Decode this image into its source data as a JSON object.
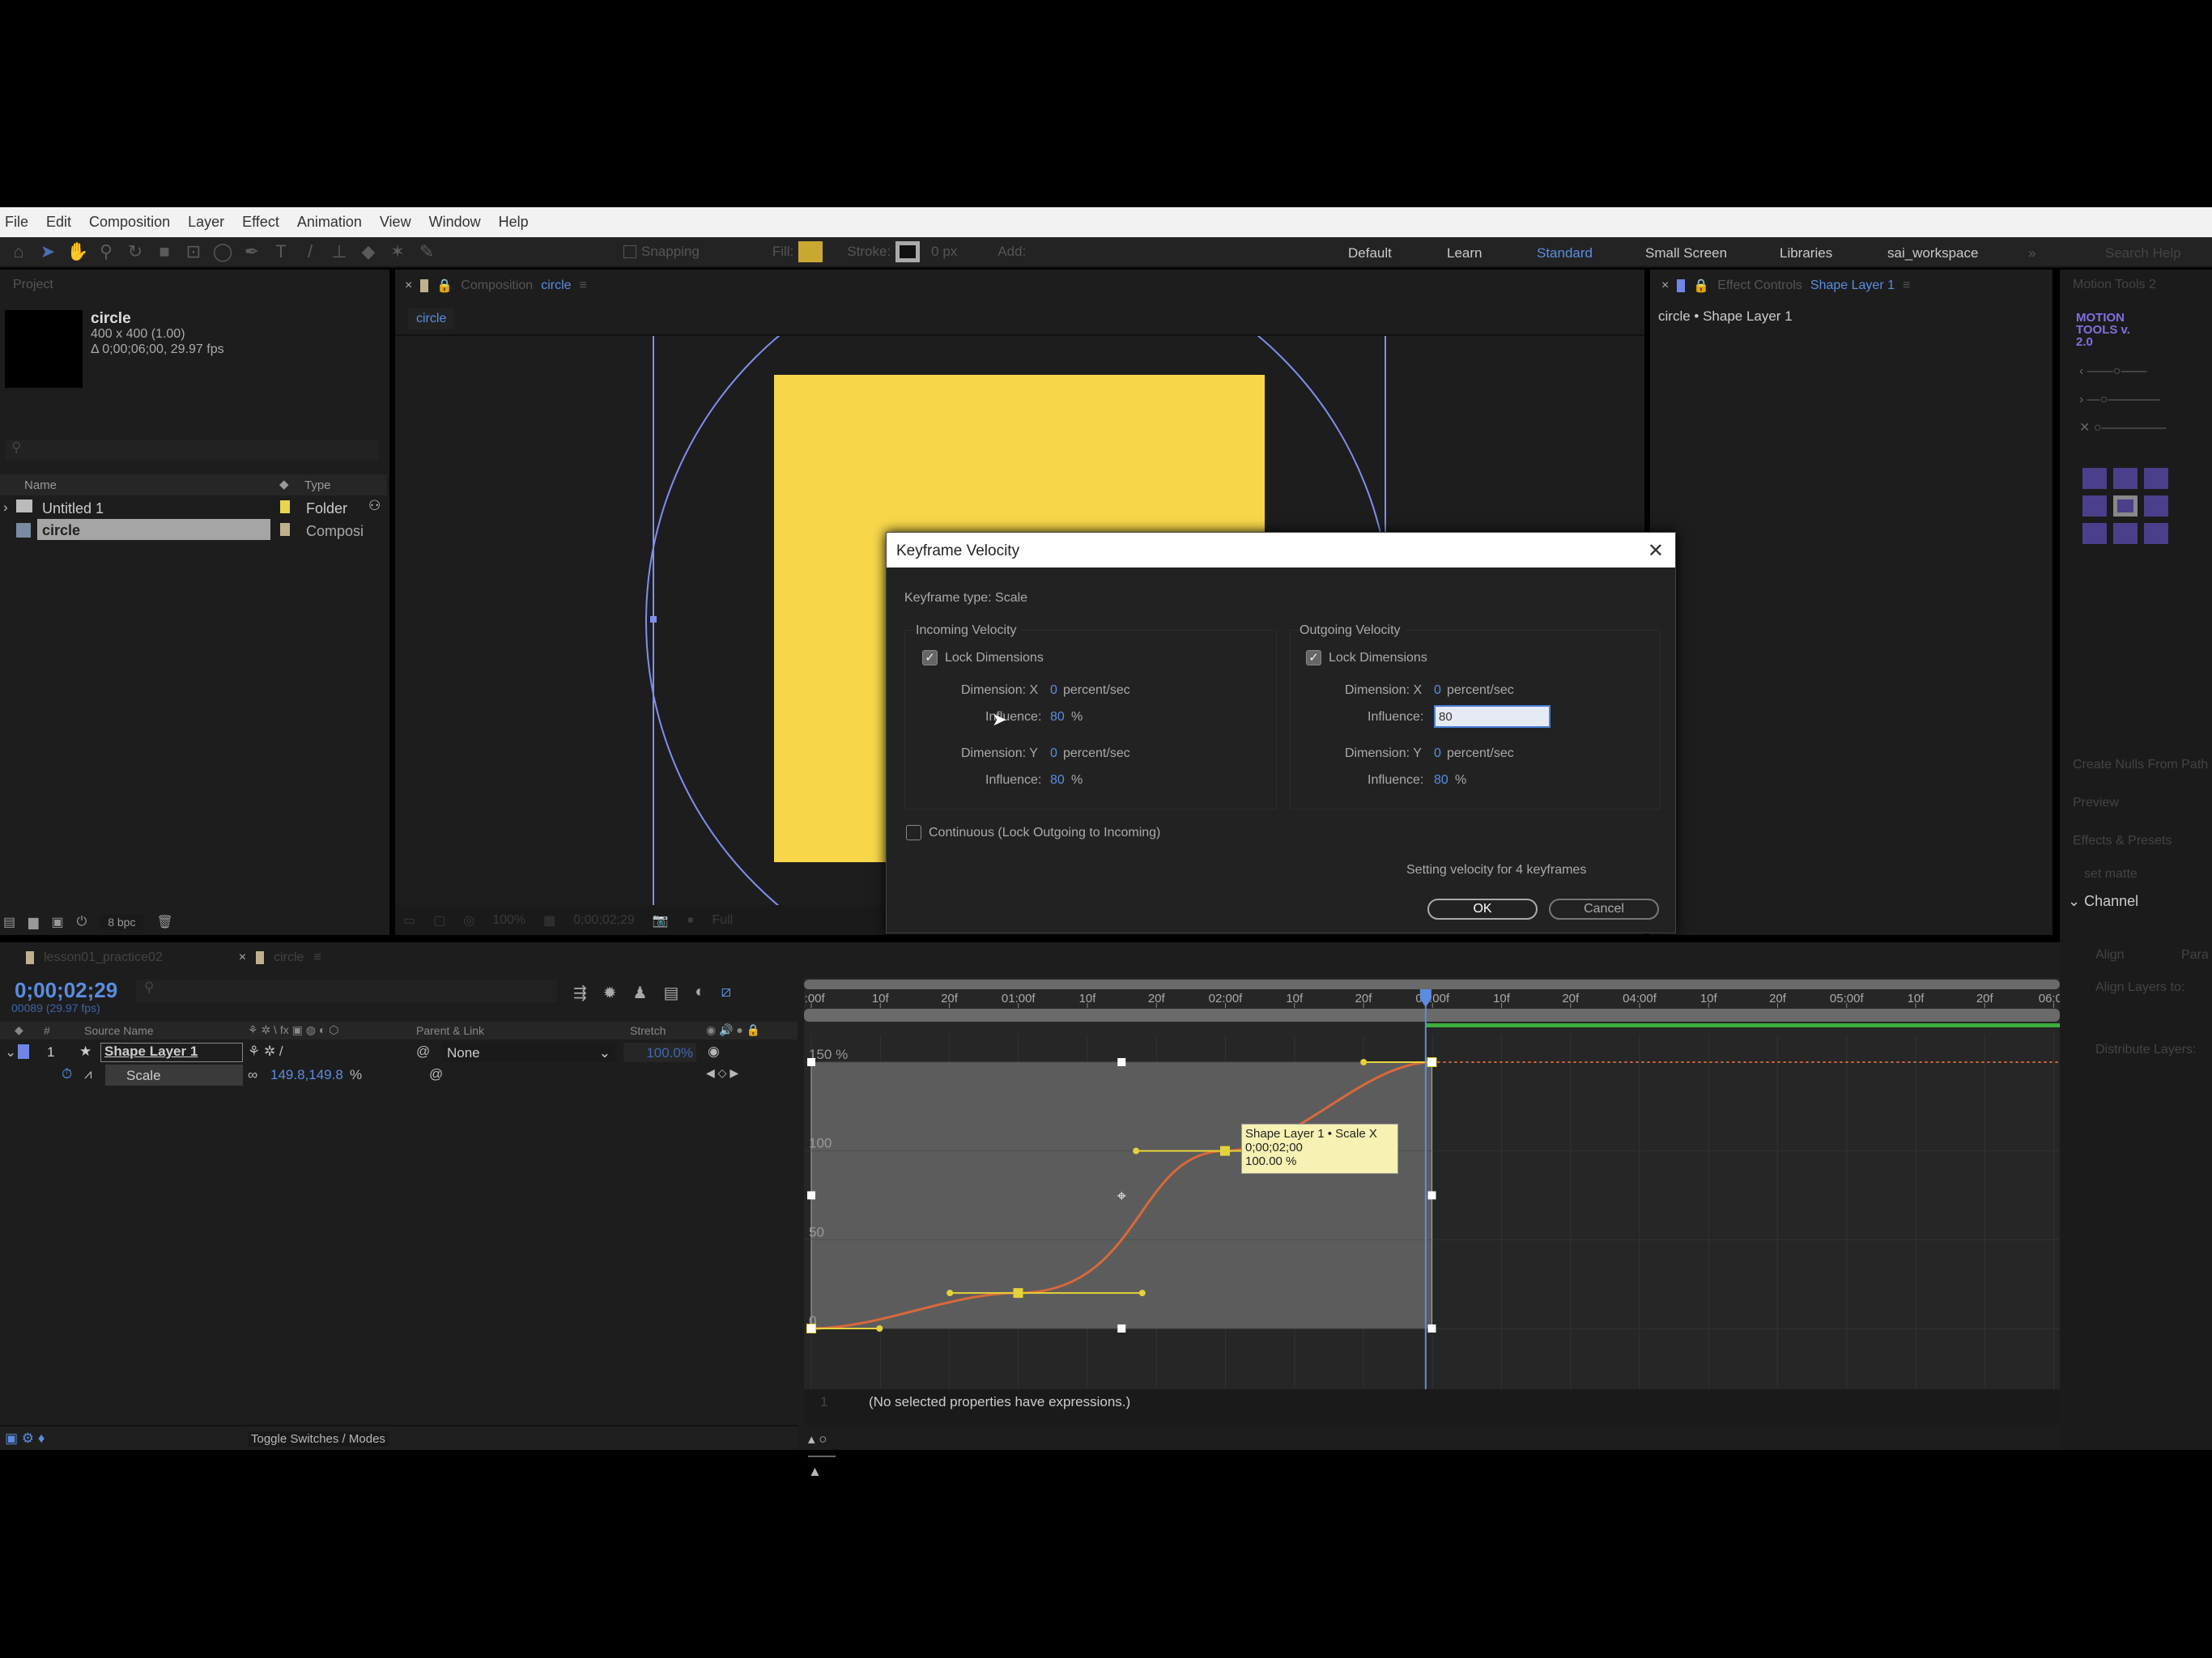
{
  "menu": [
    "File",
    "Edit",
    "Composition",
    "Layer",
    "Effect",
    "Animation",
    "View",
    "Window",
    "Help"
  ],
  "toolbar": {
    "snapping": "Snapping",
    "fill": "Fill:",
    "stroke": "Stroke:",
    "stroke_px": "0 px",
    "add": "Add:",
    "fill_color": "#c9a832",
    "search_placeholder": "Search Help"
  },
  "workspaces": [
    {
      "label": "Default"
    },
    {
      "label": "Learn"
    },
    {
      "label": "Standard",
      "active": true
    },
    {
      "label": "Small Screen"
    },
    {
      "label": "Libraries"
    },
    {
      "label": "sai_workspace"
    }
  ],
  "project": {
    "title": "Project",
    "comp_name": "circle",
    "comp_size": "400 x 400 (1.00)",
    "comp_duration": "Δ 0;00;06;00, 29.97 fps",
    "columns": {
      "name": "Name",
      "type": "Type"
    },
    "items": [
      {
        "name": "Untitled 1",
        "type": "Folder",
        "label_color": "#e8d44d"
      },
      {
        "name": "circle",
        "type": "Composi",
        "label_color": "#c0b090",
        "selected": true
      }
    ],
    "bpc": "8 bpc"
  },
  "composition": {
    "tab_prefix": "Composition",
    "tab_name": "circle",
    "breadcrumb": "circle",
    "zoom": "100%",
    "timecode": "0;00;02;29",
    "resolution": "Full",
    "shape_color": "#f7d64a",
    "path_color": "#7f8ff0"
  },
  "effect_controls": {
    "tab_prefix": "Effect Controls",
    "tab_name": "Shape Layer 1",
    "header": "circle • Shape Layer 1"
  },
  "right_panel": {
    "motion_tools_tab": "Motion Tools 2",
    "logo": "MOTION TOOLS v. 2.0",
    "create_nulls": "Create Nulls From Path",
    "preview": "Preview",
    "effects_presets": "Effects & Presets",
    "effects_search": "set matte",
    "channel": "Channel",
    "align": "Align",
    "para": "Para",
    "align_layers_to": "Align Layers to:",
    "distribute": "Distribute Layers:"
  },
  "dialog": {
    "title": "Keyframe Velocity",
    "keyframe_type": "Keyframe type: Scale",
    "incoming": {
      "title": "Incoming Velocity",
      "lock": "Lock Dimensions",
      "locked": true,
      "dim_x_label": "Dimension: X",
      "dim_x": "0",
      "dim_y_label": "Dimension: Y",
      "dim_y": "0",
      "unit": "percent/sec",
      "influence_label": "Influence:",
      "influence_x": "80",
      "influence_y": "80",
      "pct": "%"
    },
    "outgoing": {
      "title": "Outgoing Velocity",
      "lock": "Lock Dimensions",
      "locked": true,
      "dim_x_label": "Dimension: X",
      "dim_x": "0",
      "dim_y_label": "Dimension: Y",
      "dim_y": "0",
      "unit": "percent/sec",
      "influence_label": "Influence:",
      "influence_x": "80",
      "influence_y": "80",
      "pct": "%"
    },
    "continuous": "Continuous (Lock Outgoing to Incoming)",
    "continuous_checked": false,
    "status": "Setting velocity for 4 keyframes",
    "ok": "OK",
    "cancel": "Cancel"
  },
  "timeline": {
    "tabs": [
      {
        "label": "lesson01_practice02"
      },
      {
        "label": "circle",
        "active": true
      }
    ],
    "timecode": "0;00;02;29",
    "frame_info": "00089 (29.97 fps)",
    "columns": {
      "num": "#",
      "source": "Source Name",
      "parent": "Parent & Link",
      "stretch": "Stretch"
    },
    "layer": {
      "index": "1",
      "name": "Shape Layer 1",
      "parent": "None",
      "stretch": "100.0%",
      "color": "#6f86e6"
    },
    "property": {
      "name": "Scale",
      "value": "149.8,149.8",
      "unit": "%"
    },
    "ruler": [
      "0:00f",
      "10f",
      "20f",
      "01:00f",
      "10f",
      "20f",
      "02:00f",
      "10f",
      "20f",
      "03:00f",
      "10f",
      "20f",
      "04:00f",
      "10f",
      "20f",
      "05:00f",
      "10f",
      "20f",
      "06:00"
    ],
    "current_time_sec": 2.97,
    "toggle": "Toggle Switches / Modes",
    "expressions_line": "1",
    "expressions_msg": "(No selected properties have expressions.)"
  },
  "graph_editor": {
    "y_labels": [
      "150 %",
      "100",
      "50",
      "0"
    ],
    "y_range": [
      0,
      150
    ],
    "time_range_sec": [
      0,
      6
    ],
    "curve_color": "#d8693a",
    "handle_color": "#e4d23a",
    "keyframes": [
      {
        "t": 0,
        "v": 0,
        "in": 0.33,
        "out": 0.33
      },
      {
        "t": 1,
        "v": 20,
        "in": 0.33,
        "out": 0.6
      },
      {
        "t": 2,
        "v": 100,
        "in": 0.43,
        "out": 0.33
      },
      {
        "t": 3,
        "v": 150,
        "in": 0.33,
        "out": 0.33
      }
    ],
    "tooltip": {
      "line1": "Shape Layer 1 • Scale X",
      "line2": "0;00;02;00",
      "line3": "100.00 %"
    }
  }
}
